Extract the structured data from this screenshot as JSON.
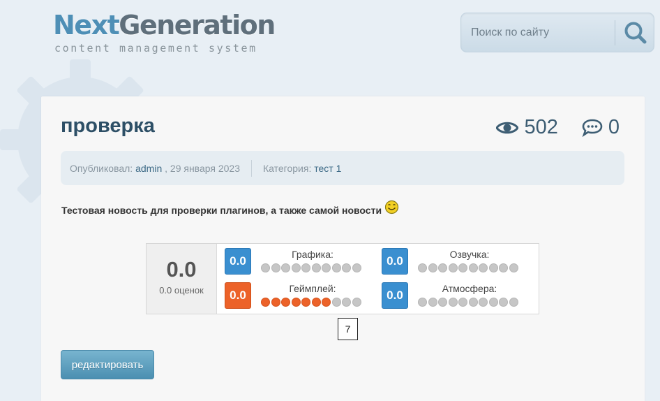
{
  "logo": {
    "brand_part1": "Next",
    "brand_part2": "Generation",
    "tagline": "content management system"
  },
  "search": {
    "placeholder": "Поиск по сайту",
    "icon": "search-icon"
  },
  "article": {
    "title": "проверка",
    "views": "502",
    "comments": "0",
    "meta": {
      "published_label": "Опубликовал:",
      "author": "admin",
      "date": ", 29 января 2023",
      "category_label": "Категория:",
      "category": "тест 1"
    },
    "description": "Тестовая новость для проверки плагинов, а также самой новости"
  },
  "rating": {
    "total_value": "0.0",
    "total_count": "0.0 оценок",
    "dots_per_row": 10,
    "criteria": [
      {
        "label": "Графика:",
        "value": "0.0",
        "color": "#3a8fd0",
        "filled": 0
      },
      {
        "label": "Озвучка:",
        "value": "0.0",
        "color": "#3a8fd0",
        "filled": 0
      },
      {
        "label": "Геймплей:",
        "value": "0.0",
        "color": "#ec6229",
        "filled": 7
      },
      {
        "label": "Атмосфера:",
        "value": "0.0",
        "color": "#3a8fd0",
        "filled": 0
      }
    ],
    "hover_tooltip": "7"
  },
  "actions": {
    "edit_label": "редактировать"
  },
  "colors": {
    "accent": "#4e8fb6",
    "page_bg": "#e8eff5",
    "card_bg": "#f7f7f7"
  }
}
